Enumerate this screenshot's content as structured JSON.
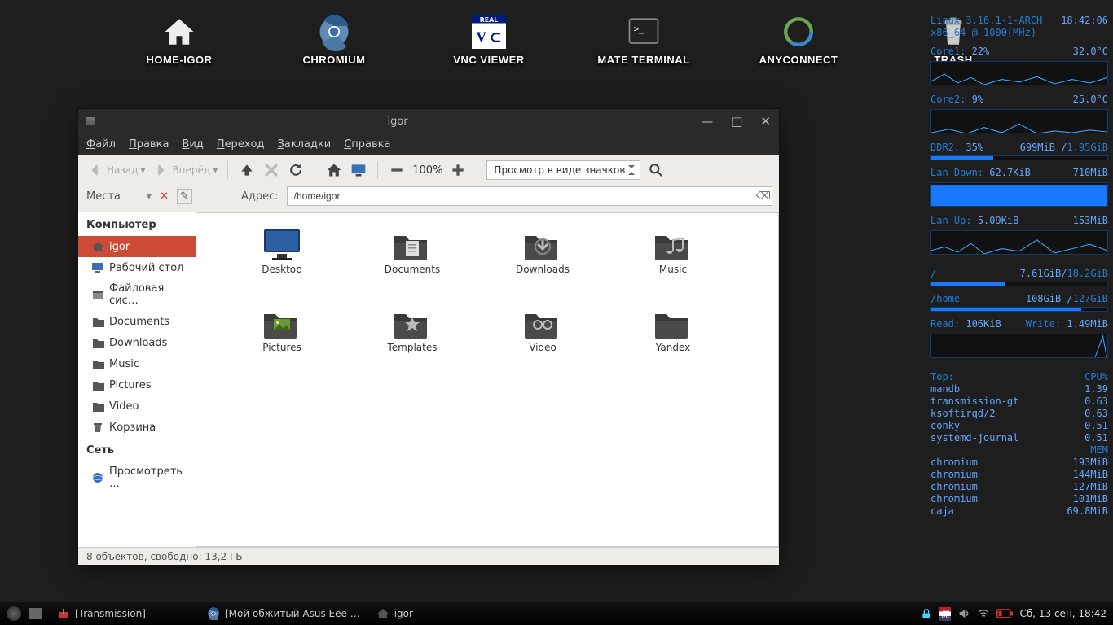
{
  "desktop_icons": [
    {
      "name": "home-igor",
      "label": "HOME-IGOR",
      "icon": "home"
    },
    {
      "name": "chromium",
      "label": "CHROMIUM",
      "icon": "chromium"
    },
    {
      "name": "vnc-viewer",
      "label": "VNC VIEWER",
      "icon": "vnc"
    },
    {
      "name": "mate-terminal",
      "label": "MATE TERMINAL",
      "icon": "terminal"
    },
    {
      "name": "anyconnect",
      "label": "ANYCONNECT",
      "icon": "anyconnect"
    },
    {
      "name": "trash",
      "label": "TRASH",
      "icon": "trash"
    }
  ],
  "conky": {
    "kernel": "Linux 3.16.1-1-ARCH",
    "clock": "18:42:06",
    "arch": "x86_64 @ 1000(MHz)",
    "core1_label": "Core1:",
    "core1_pct": "22%",
    "core1_temp": "32.0°C",
    "core2_label": "Core2:",
    "core2_pct": "9%",
    "core2_temp": "25.0°C",
    "ddr_label": "DDR2:",
    "ddr_pct": "35%",
    "ddr_used": "699MiB /",
    "ddr_total": "1.95GiB",
    "lan_down_label": "Lan Down:",
    "lan_down_rate": "62.7KiB",
    "lan_down_total": "710MiB",
    "lan_up_label": "Lan Up:",
    "lan_up_rate": "5.09KiB",
    "lan_up_total": "153MiB",
    "root_label": "/",
    "root_used": "7.61GiB/",
    "root_total": "18.2GiB",
    "home_label": "/home",
    "home_used": "108GiB /",
    "home_total": "127GiB",
    "read_label": "Read:",
    "read_val": "106KiB",
    "write_label": "Write:",
    "write_val": "1.49MiB",
    "top_label": "Top:",
    "cpu_col": "CPU%",
    "mem_col": "MEM",
    "top_cpu": [
      [
        "mandb",
        "1.39"
      ],
      [
        "transmission-gt",
        "0.63"
      ],
      [
        "ksoftirqd/2",
        "0.63"
      ],
      [
        "conky",
        "0.51"
      ],
      [
        "systemd-journal",
        "0.51"
      ]
    ],
    "top_mem": [
      [
        "chromium",
        "193MiB"
      ],
      [
        "chromium",
        "144MiB"
      ],
      [
        "chromium",
        "127MiB"
      ],
      [
        "chromium",
        "101MiB"
      ],
      [
        "caja",
        "69.8MiB"
      ]
    ]
  },
  "filemanager": {
    "title": "igor",
    "menu": [
      "Файл",
      "Правка",
      "Вид",
      "Переход",
      "Закладки",
      "Справка"
    ],
    "back_label": "Назад",
    "fwd_label": "Вперёд",
    "zoom_pct": "100%",
    "view_mode": "Просмотр в виде значков",
    "places_label": "Места",
    "address_label": "Адрес:",
    "address_value": "/home/igor",
    "sidebar_groups": [
      {
        "title": "Компьютер",
        "items": [
          {
            "icon": "home",
            "label": "igor",
            "selected": true
          },
          {
            "icon": "desktop",
            "label": "Рабочий стол"
          },
          {
            "icon": "fs",
            "label": "Файловая сис…"
          },
          {
            "icon": "folder",
            "label": "Documents"
          },
          {
            "icon": "folder",
            "label": "Downloads"
          },
          {
            "icon": "folder",
            "label": "Music"
          },
          {
            "icon": "folder",
            "label": "Pictures"
          },
          {
            "icon": "folder",
            "label": "Video"
          },
          {
            "icon": "trash",
            "label": "Корзина"
          }
        ]
      },
      {
        "title": "Сеть",
        "items": [
          {
            "icon": "globe",
            "label": "Просмотреть …"
          }
        ]
      }
    ],
    "items": [
      {
        "label": "Desktop",
        "icon": "desktop-monitor"
      },
      {
        "label": "Documents",
        "icon": "folder-docs"
      },
      {
        "label": "Downloads",
        "icon": "folder-down"
      },
      {
        "label": "Music",
        "icon": "folder-music"
      },
      {
        "label": "Pictures",
        "icon": "folder-pics"
      },
      {
        "label": "Templates",
        "icon": "folder-templ"
      },
      {
        "label": "Video",
        "icon": "folder-video"
      },
      {
        "label": "Yandex",
        "icon": "folder-plain"
      }
    ],
    "status": "8 объектов, свободно: 13,2 ГБ"
  },
  "taskbar": {
    "tasks": [
      {
        "icon": "transmission",
        "label": "[Transmission]"
      },
      {
        "icon": "chromium",
        "label": "[Мой обжитый Asus Eee …"
      },
      {
        "icon": "home",
        "label": "igor"
      }
    ],
    "clock": "Сб, 13 сен, 18:42"
  }
}
